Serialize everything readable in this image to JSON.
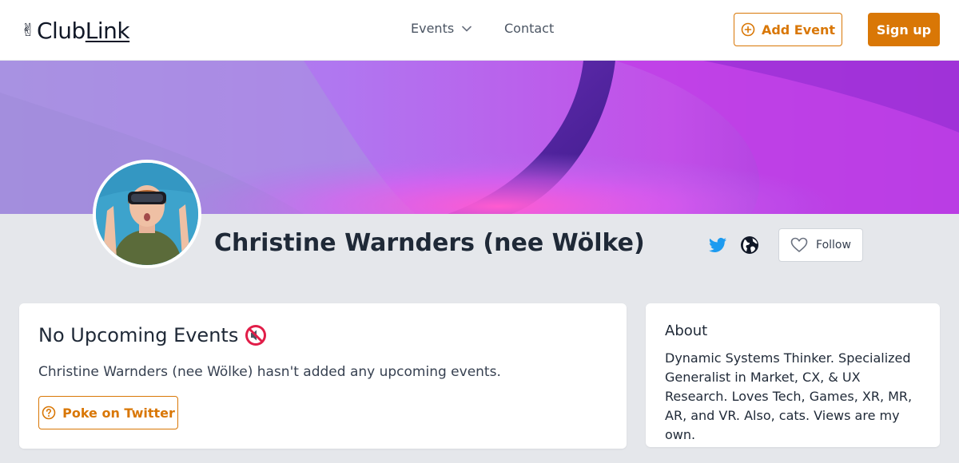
{
  "header": {
    "logo_prefix": "Club",
    "logo_suffix": "Link",
    "nav_events": "Events",
    "nav_contact": "Contact",
    "add_event_label": "Add Event",
    "signup_label": "Sign up"
  },
  "profile": {
    "name": "Christine Warnders (nee Wölke)",
    "follow_label": "Follow"
  },
  "events": {
    "title": "No Upcoming Events",
    "message": "Christine Warnders (nee Wölke) hasn't added any upcoming events.",
    "poke_label": "Poke on Twitter"
  },
  "about": {
    "title": "About",
    "text": "Dynamic Systems Thinker. Specialized Generalist in Market, CX, & UX Research. Loves Tech, Games, XR, MR, AR, and VR. Also, cats. Views are my own."
  },
  "colors": {
    "accent": "#d97706",
    "twitter": "#1d9bf0",
    "background": "#e5e7eb"
  },
  "icons": {
    "logo": "victory-hand-icon",
    "events_dropdown": "chevron-down-icon",
    "add_event": "plus-circle-icon",
    "twitter": "twitter-icon",
    "website": "globe-icon",
    "follow": "heart-icon",
    "events_title": "muted-speaker-icon",
    "poke": "question-circle-icon"
  }
}
